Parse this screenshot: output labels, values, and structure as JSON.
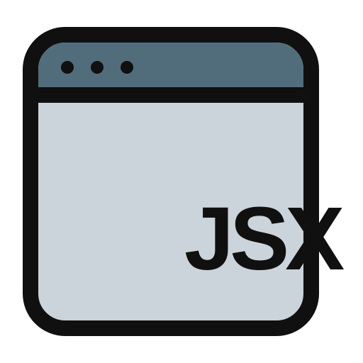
{
  "icon": {
    "label": "JSX",
    "colors": {
      "outline": "#101010",
      "titlebar": "#516d7b",
      "body": "#cbd4da"
    }
  }
}
